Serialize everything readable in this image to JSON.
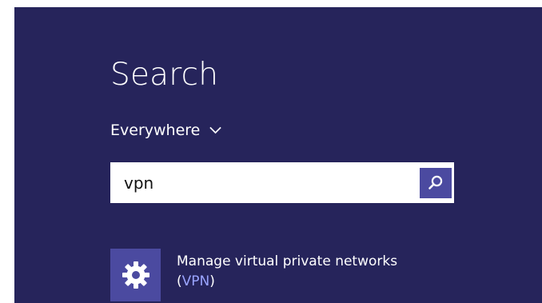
{
  "search_pane": {
    "title": "Search",
    "scope": {
      "label": "Everywhere",
      "icon": "chevron-down-icon"
    },
    "query": "vpn",
    "search_icon": "search-icon"
  },
  "results": [
    {
      "icon": "gear-icon",
      "title_line_1": "Manage virtual private networks",
      "title_line_2_prefix": "(",
      "title_line_2_highlight": "VPN",
      "title_line_2_suffix": ")"
    }
  ],
  "colors": {
    "background": "#26245b",
    "tile": "#4b4aa0",
    "text": "#ffffff",
    "highlight": "#9aa4ff",
    "input_background": "#ffffff"
  }
}
